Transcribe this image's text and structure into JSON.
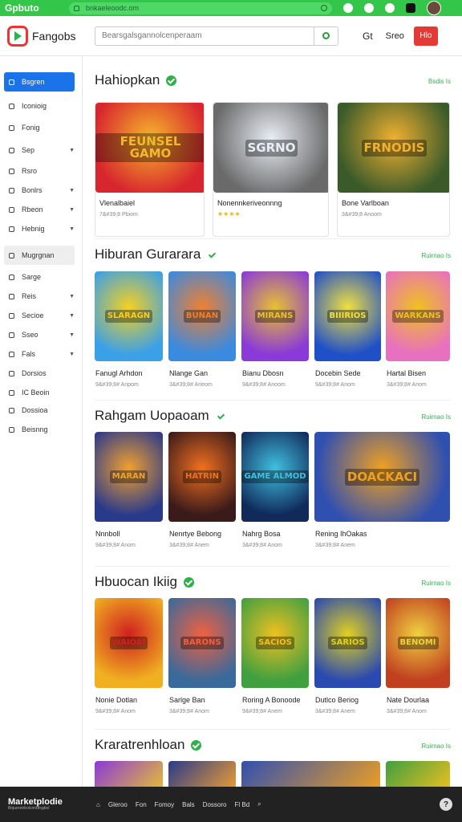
{
  "browser": {
    "brand": "Gpbuto",
    "url": "bnkaeleoodc.om"
  },
  "header": {
    "logo_text": "Fangobs",
    "search_placeholder": "Bearsgalsgannolcenperaam",
    "icon_label": "Gt",
    "text_label": "Sreo",
    "button_label": "Hlo"
  },
  "sidebar": {
    "items": [
      {
        "label": "Bsgren",
        "active": true,
        "chevron": false
      },
      {
        "label": "Iconioig",
        "chevron": false
      },
      {
        "label": "Fonig",
        "chevron": false
      },
      {
        "label": "Sep",
        "chevron": true
      },
      {
        "label": "Rsro",
        "chevron": false
      },
      {
        "label": "Bonlrs",
        "chevron": true
      },
      {
        "label": "Rbeon",
        "chevron": true
      },
      {
        "label": "Hebnig",
        "chevron": true
      },
      {
        "label": "Mugrgnan",
        "grey": true,
        "chevron": false
      },
      {
        "label": "Sarge",
        "chevron": false
      },
      {
        "label": "Reis",
        "chevron": true
      },
      {
        "label": "Secioe",
        "chevron": true
      },
      {
        "label": "Sseo",
        "chevron": true
      },
      {
        "label": "Fals",
        "chevron": true
      },
      {
        "label": "Dorsios",
        "chevron": false
      },
      {
        "label": "IC Beoin",
        "chevron": false
      },
      {
        "label": "Dossioa",
        "chevron": false
      },
      {
        "label": "Beisnng",
        "chevron": false
      }
    ]
  },
  "sections": [
    {
      "title": "Hahiopkan",
      "see_all": "Bsdis Is",
      "cards": [
        {
          "art": "FEUNSEL GAMO",
          "title": "Vlenalbaiel",
          "sub": "7&#39;8 Pbiom"
        },
        {
          "art": "SGRNO",
          "title": "Nonennkeriveonnng",
          "sub": "",
          "stars": "★★★★"
        },
        {
          "art": "FRNODIS",
          "title": "Bone Varlboan",
          "sub": "3&#39;8 Anoom"
        }
      ]
    },
    {
      "title": "Hiburan Gurarara",
      "see_all": "Ruirnao Is",
      "cards": [
        {
          "art": "SLARAGN",
          "title": "Fanugl Arhdon",
          "sub": "9&#39;8# Anpom"
        },
        {
          "art": "BUNAN",
          "title": "Nlange Gan",
          "sub": "3&#39;8# Arieom"
        },
        {
          "art": "MIRANS",
          "title": "Bianu Dbosn",
          "sub": "9&#39;8# Anoom"
        },
        {
          "art": "BIIIRIOS",
          "title": "Docebin Sede",
          "sub": "9&#39;8# Anom"
        },
        {
          "art": "WARKANS",
          "title": "Hartal Bisen",
          "sub": "3&#39;8# Anom"
        }
      ]
    },
    {
      "title": "Rahgam Uopaoam",
      "see_all": "Ruirnao Is",
      "cards": [
        {
          "art": "MARAN",
          "title": "Nnnboll",
          "sub": "9&#39;8# Anom"
        },
        {
          "art": "HATRIN",
          "title": "Nenrtye Bebong",
          "sub": "3&#39;8# Anem"
        },
        {
          "art": "GAME ALMOD",
          "title": "Nahrg Bosa",
          "sub": "3&#39;8# Anom"
        },
        {
          "art": "DOACKACI",
          "title": "Rening IhOakas",
          "sub": "3&#39;8# Anem"
        }
      ]
    },
    {
      "title": "Hbuocan Ikiig",
      "see_all": "Ruirnao Is",
      "cards": [
        {
          "art": "WAIOAI",
          "title": "Nonie Dotlan",
          "sub": "9&#39;8# Anom"
        },
        {
          "art": "BARONS",
          "title": "Sarlge Ban",
          "sub": "3&#39;8# Anom"
        },
        {
          "art": "SACIOS",
          "title": "Roring A Bonoode",
          "sub": "9&#39;8# Anem"
        },
        {
          "art": "SARIOS",
          "title": "Dutlco Beriog",
          "sub": "3&#39;8# Anem"
        },
        {
          "art": "BENOMI",
          "title": "Nate Dourlaa",
          "sub": "3&#39;8# Anom"
        }
      ]
    },
    {
      "title": "Kraratrenhloan",
      "see_all": "Ruirnao Is",
      "cards": []
    }
  ],
  "footer": {
    "brand": "Marketplodie",
    "brand_sub": "Biqueretrbolcnnbfogbol",
    "links": [
      "Gleroo",
      "Fon",
      "Fomoy",
      "Bals",
      "Dossoro",
      "Fl Bd"
    ]
  },
  "colors": {
    "accent_green": "#2fb14a",
    "top_bar": "#33c64a",
    "primary_blue": "#1a73e8",
    "danger_red": "#e53935"
  }
}
